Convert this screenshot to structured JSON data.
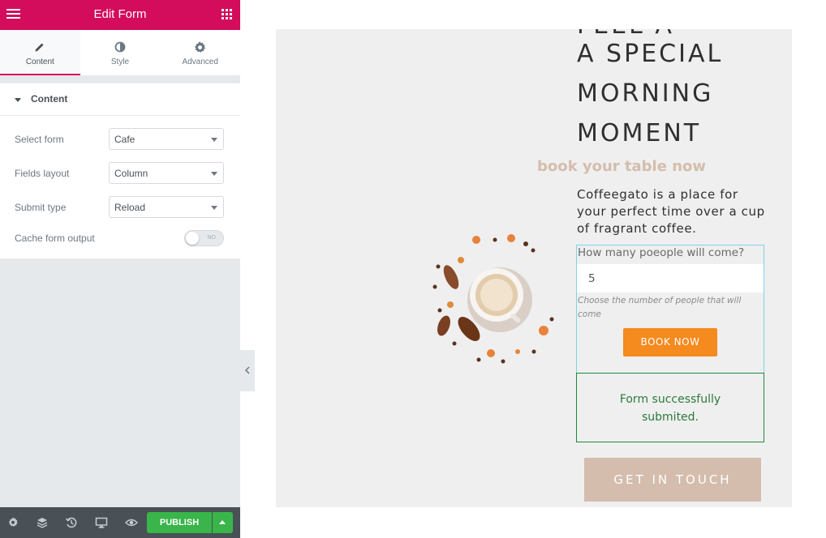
{
  "panel": {
    "title": "Edit Form",
    "tabs": [
      {
        "label": "Content",
        "icon": "pencil-icon",
        "active": true
      },
      {
        "label": "Style",
        "icon": "half-circle-icon",
        "active": false
      },
      {
        "label": "Advanced",
        "icon": "gear-icon",
        "active": false
      }
    ],
    "section": "Content",
    "controls": {
      "select_form": {
        "label": "Select form",
        "value": "Cafe"
      },
      "fields_layout": {
        "label": "Fields layout",
        "value": "Column"
      },
      "submit_type": {
        "label": "Submit type",
        "value": "Reload"
      },
      "cache_output": {
        "label": "Cache form output",
        "state": "NO"
      }
    },
    "footer": {
      "icons": [
        "settings-icon",
        "layers-icon",
        "history-icon",
        "responsive-icon",
        "preview-eye-icon"
      ],
      "publish_label": "PUBLISH"
    }
  },
  "preview": {
    "headline_cut": "FEEL A",
    "headline": "A SPECIAL MORNING MOMENT",
    "subtitle": "book your table now",
    "description": "Coffeegato is a place for your perfect time over a cup of fragrant coffee.",
    "form": {
      "question_label": "How many poeople will come?",
      "input_value": "5",
      "help_text": "Choose the number of people that will come",
      "submit_label": "BOOK NOW"
    },
    "success_message": "Form successfully submited.",
    "cta_label": "GET IN TOUCH"
  },
  "colors": {
    "brand": "#d30c5c",
    "publish": "#39b54a",
    "book_button": "#f58a1f",
    "accent_beige": "#d4bdad",
    "success_border": "#1e8a3a",
    "form_outline": "#7fd3e8"
  }
}
